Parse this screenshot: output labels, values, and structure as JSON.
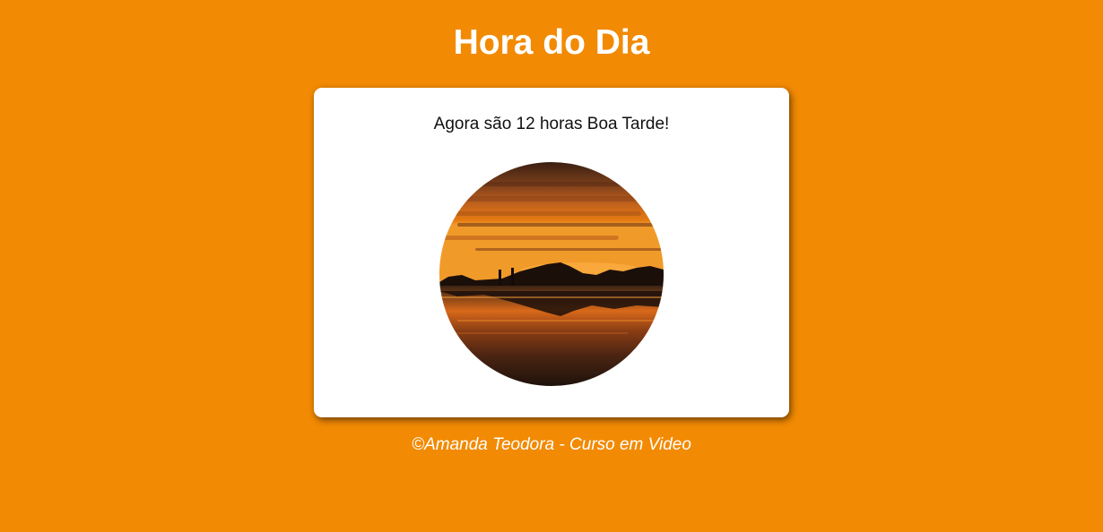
{
  "header": {
    "title": "Hora do Dia"
  },
  "card": {
    "message": "Agora são 12 horas Boa Tarde!",
    "image_subject": "sunset-beach-photo"
  },
  "footer": {
    "text": "©Amanda Teodora - Curso em Video"
  },
  "colors": {
    "background": "#f28a03",
    "card": "#ffffff",
    "title_text": "#ffffff"
  }
}
